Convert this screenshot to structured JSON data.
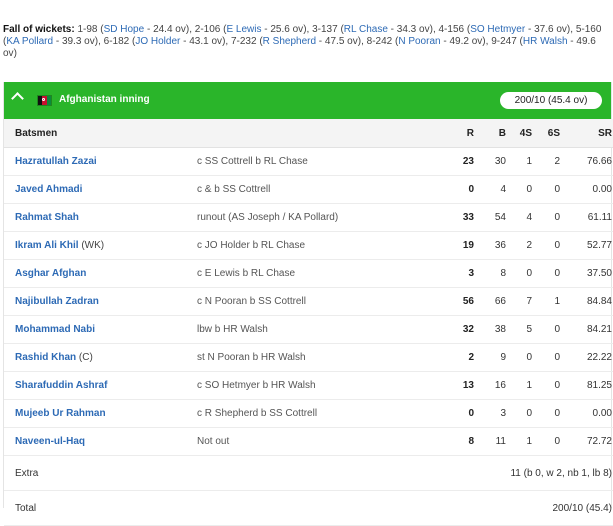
{
  "fall_of_wickets": {
    "label": "Fall of wickets:",
    "items": [
      {
        "score": "1-98",
        "player": "SD Hope",
        "over": "24.4 ov",
        "sep": ", "
      },
      {
        "score": "2-106",
        "player": "E Lewis",
        "over": "25.6 ov",
        "sep": ", "
      },
      {
        "score": "3-137",
        "player": "RL Chase",
        "over": "34.3 ov",
        "sep": ", "
      },
      {
        "score": "4-156",
        "player": "SO Hetmyer",
        "over": "37.6 ov",
        "sep": ", "
      },
      {
        "score": "5-160",
        "player": "KA Pollard",
        "over": "39.3 ov",
        "sep": ", "
      },
      {
        "score": "6-182",
        "player": "JO Holder",
        "over": "43.1 ov",
        "sep": ", "
      },
      {
        "score": "7-232",
        "player": "R Shepherd",
        "over": "47.5 ov",
        "sep": ", "
      },
      {
        "score": "8-242",
        "player": "N Pooran",
        "over": "49.2 ov",
        "sep": ", "
      },
      {
        "score": "9-247",
        "player": "HR Walsh",
        "over": "49.6 ov",
        "sep": ""
      }
    ]
  },
  "innings": {
    "title": "Afghanistan inning",
    "score": "200/10 (45.4 ov)",
    "flag_icon": "afghanistan-flag-icon",
    "toggle_icon": "chevron-up-icon",
    "header_color": "#2ab52a"
  },
  "table": {
    "headers": {
      "batsmen": "Batsmen",
      "runs": "R",
      "balls": "B",
      "fours": "4S",
      "sixes": "6S",
      "sr": "SR"
    },
    "rows": [
      {
        "name": "Hazratullah Zazai",
        "role": "",
        "dismissal": "c SS Cottrell b RL Chase",
        "r": "23",
        "b": "30",
        "fours": "1",
        "sixes": "2",
        "sr": "76.66"
      },
      {
        "name": "Javed Ahmadi",
        "role": "",
        "dismissal": "c & b SS Cottrell",
        "r": "0",
        "b": "4",
        "fours": "0",
        "sixes": "0",
        "sr": "0.00"
      },
      {
        "name": "Rahmat Shah",
        "role": "",
        "dismissal": "runout (AS Joseph / KA Pollard)",
        "r": "33",
        "b": "54",
        "fours": "4",
        "sixes": "0",
        "sr": "61.11"
      },
      {
        "name": "Ikram Ali Khil",
        "role": "(WK)",
        "dismissal": "c JO Holder b RL Chase",
        "r": "19",
        "b": "36",
        "fours": "2",
        "sixes": "0",
        "sr": "52.77"
      },
      {
        "name": "Asghar Afghan",
        "role": "",
        "dismissal": "c E Lewis b RL Chase",
        "r": "3",
        "b": "8",
        "fours": "0",
        "sixes": "0",
        "sr": "37.50"
      },
      {
        "name": "Najibullah Zadran",
        "role": "",
        "dismissal": "c N Pooran b SS Cottrell",
        "r": "56",
        "b": "66",
        "fours": "7",
        "sixes": "1",
        "sr": "84.84"
      },
      {
        "name": "Mohammad Nabi",
        "role": "",
        "dismissal": "lbw b HR Walsh",
        "r": "32",
        "b": "38",
        "fours": "5",
        "sixes": "0",
        "sr": "84.21"
      },
      {
        "name": "Rashid Khan",
        "role": "(C)",
        "dismissal": "st N Pooran b HR Walsh",
        "r": "2",
        "b": "9",
        "fours": "0",
        "sixes": "0",
        "sr": "22.22"
      },
      {
        "name": "Sharafuddin Ashraf",
        "role": "",
        "dismissal": "c SO Hetmyer b HR Walsh",
        "r": "13",
        "b": "16",
        "fours": "1",
        "sixes": "0",
        "sr": "81.25"
      },
      {
        "name": "Mujeeb Ur Rahman",
        "role": "",
        "dismissal": "c R Shepherd b SS Cottrell",
        "r": "0",
        "b": "3",
        "fours": "0",
        "sixes": "0",
        "sr": "0.00"
      },
      {
        "name": "Naveen-ul-Haq",
        "role": "",
        "dismissal": "Not out",
        "r": "8",
        "b": "11",
        "fours": "1",
        "sixes": "0",
        "sr": "72.72"
      }
    ],
    "extra": {
      "label": "Extra",
      "value": "11 (b 0, w 2, nb 1, lb 8)"
    },
    "total": {
      "label": "Total",
      "value": "200/10 (45.4)"
    }
  }
}
